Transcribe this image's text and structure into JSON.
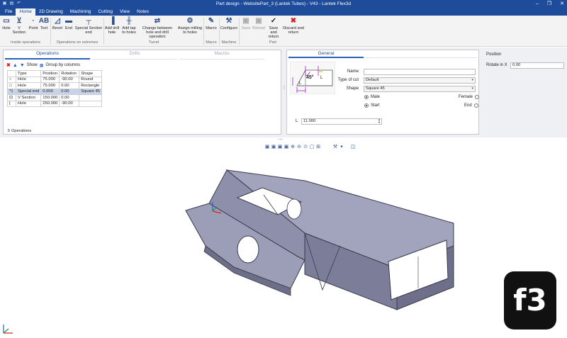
{
  "window": {
    "title": "Part design - WebsitePart_3 (Lantek Tubes) - V43 - Lantek Flex3d",
    "controls": [
      "–",
      "❐",
      "✕"
    ]
  },
  "menu": [
    "File",
    "Home",
    "2D Drawing",
    "Machining",
    "Cutting",
    "View",
    "Notes"
  ],
  "menu_active": "Home",
  "ribbon": {
    "buttons": [
      {
        "label": "Hole",
        "icon": "hole-icon"
      },
      {
        "label": "V Section",
        "icon": "v-section-icon"
      },
      {
        "label": "Point",
        "icon": "point-icon"
      },
      {
        "label": "Text",
        "icon": "text-icon"
      },
      {
        "label": "Bevel",
        "icon": "bevel-icon"
      },
      {
        "label": "End",
        "icon": "end-icon"
      },
      {
        "label": "Special Section end",
        "icon": "special-section-icon"
      },
      {
        "label": "Add drill hole",
        "icon": "drill-icon"
      },
      {
        "label": "Add tap to holes",
        "icon": "tap-icon"
      },
      {
        "label": "Change between hole and drill operation",
        "icon": "change-icon"
      },
      {
        "label": "Assign milling to holes",
        "icon": "milling-icon"
      },
      {
        "label": "Macro",
        "icon": "macro-icon"
      },
      {
        "label": "Configure",
        "icon": "configure-icon"
      },
      {
        "label": "Save",
        "icon": "save-icon"
      },
      {
        "label": "Reload",
        "icon": "reload-icon"
      },
      {
        "label": "Save and return",
        "icon": "check-icon"
      },
      {
        "label": "Discard and return",
        "icon": "discard-icon"
      }
    ],
    "groups": [
      "Inside operations",
      "Operations on extremes",
      "Turret",
      "Macro",
      "Machine",
      "Part"
    ]
  },
  "operations": {
    "tabs": [
      "Operations",
      "Drills",
      "Macros"
    ],
    "toolbar": {
      "show": "Show",
      "group": "Group by columns"
    },
    "columns": [
      "Type",
      "Position",
      "Rotation",
      "Shape"
    ],
    "rows": [
      {
        "icon": "circle-icon",
        "type": "Hole",
        "position": "75.000",
        "rotation": "-90.00",
        "shape": "Round"
      },
      {
        "icon": "square-icon",
        "type": "Hole",
        "position": "75.000",
        "rotation": "0.00",
        "shape": "Rectangle"
      },
      {
        "icon": "special-icon",
        "type": "Special end",
        "position": "0.000",
        "rotation": "0.00",
        "shape": "Square 45"
      },
      {
        "icon": "vsection-icon",
        "type": "V Section",
        "position": "150.000",
        "rotation": "0.00",
        "shape": ""
      },
      {
        "icon": "circle-icon",
        "type": "Hole",
        "position": "250.000",
        "rotation": "-90.00",
        "shape": ""
      }
    ],
    "count": "5 Operations"
  },
  "general": {
    "tab": "General",
    "angle": "45°",
    "l_label": "L",
    "name_label": "Name",
    "name_value": "",
    "type_label": "Type of cut",
    "type_value": "Default",
    "shape_label": "Shape",
    "shape_value": "Square 45",
    "male": "Male",
    "female": "Female",
    "start": "Start",
    "end": "End",
    "l_field_label": "L",
    "l_value": "11.000"
  },
  "position": {
    "title": "Position",
    "rotate_label": "Rotate in X",
    "rotate_value": "0.00"
  },
  "badge": "f3",
  "colors": {
    "brand": "#1e4c9a",
    "part": "#8f90ad"
  }
}
